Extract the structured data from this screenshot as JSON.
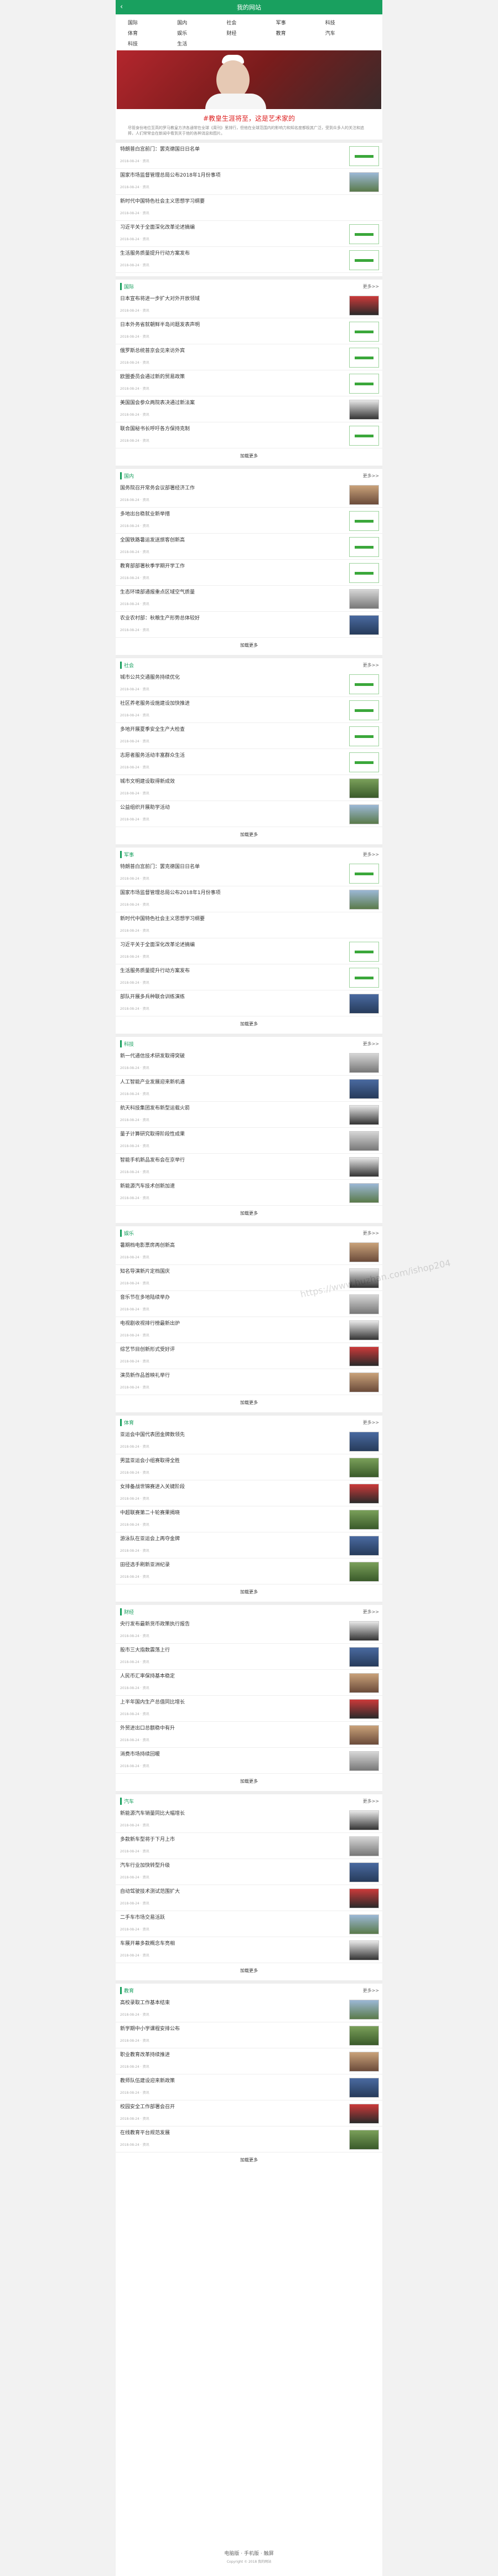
{
  "header": {
    "title": "我的网站",
    "back_icon": "chevron-left-icon"
  },
  "nav": [
    "国际",
    "国内",
    "社会",
    "军事",
    "科技",
    "体育",
    "娱乐",
    "财经",
    "教育",
    "汽车",
    "科技",
    "生活"
  ],
  "hero": {
    "headline": "#教皇生涯将至，这是艺术家的",
    "summary": "尽管身份地位至高的罗马教皇方济各通常在全球《周刊》里排行，但他在全球范围内的影响力和知名度都极其广泛，受到众多人的关注和追捧，人们常常会在新闻中看到关于他的各种消息和图片。"
  },
  "sections": [
    {
      "title": "",
      "more": "",
      "items": [
        {
          "t": "特朗普白宫前门：罢克德国日日名单",
          "m": "2018-08-24 · 资讯",
          "thumb": "ph"
        },
        {
          "t": "国家市场监督管理总局公布2018年1月份事项",
          "m": "2018-08-24 · 资讯",
          "thumb": "img1"
        },
        {
          "t": "新时代中国特色社会主义思想学习纲要",
          "m": "2018-08-24 · 资讯",
          "thumb": ""
        },
        {
          "t": "习近平关于全面深化改革论述摘编",
          "m": "2018-08-24 · 资讯",
          "thumb": "ph"
        },
        {
          "t": "生活服务质量提升行动方案发布",
          "m": "2018-08-24 · 资讯",
          "thumb": "ph"
        }
      ],
      "loadmore": ""
    },
    {
      "title": "国际",
      "more": "更多>>",
      "items": [
        {
          "t": "日本宣布将进一步扩大对外开放领域",
          "m": "2018-08-24 · 资讯",
          "thumb": "img5"
        },
        {
          "t": "日本外务省就朝鲜半岛问题发表声明",
          "m": "2018-08-24 · 资讯",
          "thumb": "ph"
        },
        {
          "t": "俄罗斯总统普京会见来访外宾",
          "m": "2018-08-24 · 资讯",
          "thumb": "ph"
        },
        {
          "t": "欧盟委员会通过新的贸易政策",
          "m": "2018-08-24 · 资讯",
          "thumb": "ph"
        },
        {
          "t": "美国国会参众两院表决通过新法案",
          "m": "2018-08-24 · 资讯",
          "thumb": "img6"
        },
        {
          "t": "联合国秘书长呼吁各方保持克制",
          "m": "2018-08-24 · 资讯",
          "thumb": "ph"
        }
      ],
      "loadmore": "加载更多"
    },
    {
      "title": "国内",
      "more": "更多>>",
      "items": [
        {
          "t": "国务院召开常务会议部署经济工作",
          "m": "2018-08-24 · 资讯",
          "thumb": "img2"
        },
        {
          "t": "多地出台稳就业新举措",
          "m": "2018-08-24 · 资讯",
          "thumb": "ph"
        },
        {
          "t": "全国铁路暑运发送旅客创新高",
          "m": "2018-08-24 · 资讯",
          "thumb": "ph"
        },
        {
          "t": "教育部部署秋季学期开学工作",
          "m": "2018-08-24 · 资讯",
          "thumb": "ph"
        },
        {
          "t": "生态环境部通报重点区域空气质量",
          "m": "2018-08-24 · 资讯",
          "thumb": "img3"
        },
        {
          "t": "农业农村部：秋粮生产形势总体较好",
          "m": "2018-08-24 · 资讯",
          "thumb": "img4"
        }
      ],
      "loadmore": "加载更多"
    },
    {
      "title": "社会",
      "more": "更多>>",
      "items": [
        {
          "t": "城市公共交通服务持续优化",
          "m": "2018-08-24 · 资讯",
          "thumb": "ph"
        },
        {
          "t": "社区养老服务设施建设加快推进",
          "m": "2018-08-24 · 资讯",
          "thumb": "ph"
        },
        {
          "t": "多地开展夏季安全生产大检查",
          "m": "2018-08-24 · 资讯",
          "thumb": "ph"
        },
        {
          "t": "志愿者服务活动丰富群众生活",
          "m": "2018-08-24 · 资讯",
          "thumb": "ph"
        },
        {
          "t": "城市文明建设取得新成效",
          "m": "2018-08-24 · 资讯",
          "thumb": "img7"
        },
        {
          "t": "公益组织开展助学活动",
          "m": "2018-08-24 · 资讯",
          "thumb": "img1"
        }
      ],
      "loadmore": "加载更多"
    },
    {
      "title": "军事",
      "more": "更多>>",
      "items": [
        {
          "t": "特朗普白宫前门：罢克德国日日名单",
          "m": "2018-08-24 · 资讯",
          "thumb": "ph"
        },
        {
          "t": "国家市场监督管理总局公布2018年1月份事项",
          "m": "2018-08-24 · 资讯",
          "thumb": "img1"
        },
        {
          "t": "新时代中国特色社会主义思想学习纲要",
          "m": "2018-08-24 · 资讯",
          "thumb": ""
        },
        {
          "t": "习近平关于全面深化改革论述摘编",
          "m": "2018-08-24 · 资讯",
          "thumb": "ph"
        },
        {
          "t": "生活服务质量提升行动方案发布",
          "m": "2018-08-24 · 资讯",
          "thumb": "ph"
        },
        {
          "t": "部队开展多兵种联合训练演练",
          "m": "2018-08-24 · 资讯",
          "thumb": "img4"
        }
      ],
      "loadmore": "加载更多"
    },
    {
      "title": "科技",
      "more": "更多>>",
      "items": [
        {
          "t": "新一代通信技术研发取得突破",
          "m": "2018-08-24 · 资讯",
          "thumb": "img3"
        },
        {
          "t": "人工智能产业发展迎来新机遇",
          "m": "2018-08-24 · 资讯",
          "thumb": "img4"
        },
        {
          "t": "航天科技集团发布新型运载火箭",
          "m": "2018-08-24 · 资讯",
          "thumb": "img6"
        },
        {
          "t": "量子计算研究取得阶段性成果",
          "m": "2018-08-24 · 资讯",
          "thumb": "img3"
        },
        {
          "t": "智能手机新品发布会在京举行",
          "m": "2018-08-24 · 资讯",
          "thumb": "img6"
        },
        {
          "t": "新能源汽车技术创新加速",
          "m": "2018-08-24 · 资讯",
          "thumb": "img1"
        }
      ],
      "loadmore": "加载更多"
    },
    {
      "title": "娱乐",
      "more": "更多>>",
      "items": [
        {
          "t": "暑期档电影票房再创新高",
          "m": "2018-08-24 · 资讯",
          "thumb": "img2"
        },
        {
          "t": "知名导演新片定档国庆",
          "m": "2018-08-24 · 资讯",
          "thumb": "img6"
        },
        {
          "t": "音乐节在多地陆续举办",
          "m": "2018-08-24 · 资讯",
          "thumb": "img3"
        },
        {
          "t": "电视剧收视排行榜最新出炉",
          "m": "2018-08-24 · 资讯",
          "thumb": "img6"
        },
        {
          "t": "综艺节目创新形式受好评",
          "m": "2018-08-24 · 资讯",
          "thumb": "img5"
        },
        {
          "t": "演员新作品首映礼举行",
          "m": "2018-08-24 · 资讯",
          "thumb": "img2"
        }
      ],
      "loadmore": "加载更多"
    },
    {
      "title": "体育",
      "more": "更多>>",
      "items": [
        {
          "t": "亚运会中国代表团金牌数领先",
          "m": "2018-08-24 · 资讯",
          "thumb": "img4"
        },
        {
          "t": "男篮亚运会小组赛取得全胜",
          "m": "2018-08-24 · 资讯",
          "thumb": "img7"
        },
        {
          "t": "女排备战世锦赛进入关键阶段",
          "m": "2018-08-24 · 资讯",
          "thumb": "img5"
        },
        {
          "t": "中超联赛第二十轮赛果揭晓",
          "m": "2018-08-24 · 资讯",
          "thumb": "img7"
        },
        {
          "t": "游泳队在亚运会上再夺金牌",
          "m": "2018-08-24 · 资讯",
          "thumb": "img4"
        },
        {
          "t": "田径选手刷新亚洲纪录",
          "m": "2018-08-24 · 资讯",
          "thumb": "img7"
        }
      ],
      "loadmore": "加载更多"
    },
    {
      "title": "财经",
      "more": "更多>>",
      "items": [
        {
          "t": "央行发布最新货币政策执行报告",
          "m": "2018-08-24 · 资讯",
          "thumb": "img6"
        },
        {
          "t": "股市三大指数震荡上行",
          "m": "2018-08-24 · 资讯",
          "thumb": "img4"
        },
        {
          "t": "人民币汇率保持基本稳定",
          "m": "2018-08-24 · 资讯",
          "thumb": "img2"
        },
        {
          "t": "上半年国内生产总值同比增长",
          "m": "2018-08-24 · 资讯",
          "thumb": "img5"
        },
        {
          "t": "外贸进出口总额稳中有升",
          "m": "2018-08-24 · 资讯",
          "thumb": "img2"
        },
        {
          "t": "消费市场持续回暖",
          "m": "2018-08-24 · 资讯",
          "thumb": "img3"
        }
      ],
      "loadmore": "加载更多"
    },
    {
      "title": "汽车",
      "more": "更多>>",
      "items": [
        {
          "t": "新能源汽车销量同比大幅增长",
          "m": "2018-08-24 · 资讯",
          "thumb": "img6"
        },
        {
          "t": "多款新车型将于下月上市",
          "m": "2018-08-24 · 资讯",
          "thumb": "img3"
        },
        {
          "t": "汽车行业加快转型升级",
          "m": "2018-08-24 · 资讯",
          "thumb": "img4"
        },
        {
          "t": "自动驾驶技术测试范围扩大",
          "m": "2018-08-24 · 资讯",
          "thumb": "img5"
        },
        {
          "t": "二手车市场交易活跃",
          "m": "2018-08-24 · 资讯",
          "thumb": "img1"
        },
        {
          "t": "车展开幕多款概念车亮相",
          "m": "2018-08-24 · 资讯",
          "thumb": "img6"
        }
      ],
      "loadmore": "加载更多"
    },
    {
      "title": "教育",
      "more": "更多>>",
      "items": [
        {
          "t": "高校录取工作基本结束",
          "m": "2018-08-24 · 资讯",
          "thumb": "img1"
        },
        {
          "t": "新学期中小学课程安排公布",
          "m": "2018-08-24 · 资讯",
          "thumb": "img7"
        },
        {
          "t": "职业教育改革持续推进",
          "m": "2018-08-24 · 资讯",
          "thumb": "img2"
        },
        {
          "t": "教师队伍建设迎来新政策",
          "m": "2018-08-24 · 资讯",
          "thumb": "img4"
        },
        {
          "t": "校园安全工作部署会召开",
          "m": "2018-08-24 · 资讯",
          "thumb": "img5"
        },
        {
          "t": "在线教育平台规范发展",
          "m": "2018-08-24 · 资讯",
          "thumb": "img7"
        }
      ],
      "loadmore": "加载更多"
    }
  ],
  "footer": {
    "links": "电脑版 · 手机版 · 触屏",
    "copy": "Copyright © 2018 我的网站"
  },
  "watermark": "https://www.huzhan.com/ishop204"
}
